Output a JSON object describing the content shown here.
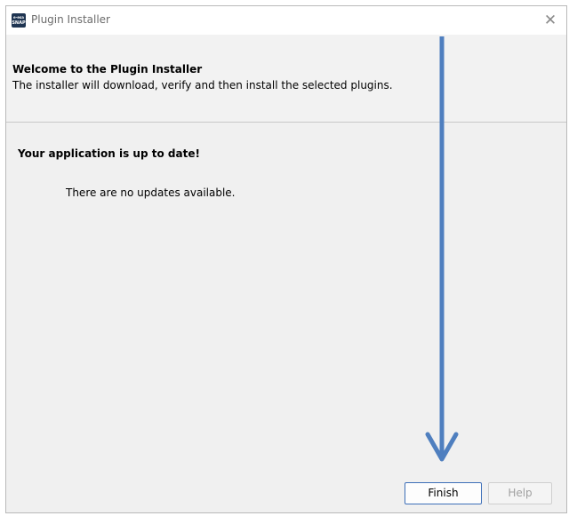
{
  "window": {
    "title": "Plugin Installer",
    "app_icon_top": "e·esa",
    "app_icon_bottom": "SNAP",
    "close_glyph": "✕"
  },
  "header": {
    "title": "Welcome to the Plugin Installer",
    "subtitle": "The installer will download, verify and then install the selected plugins."
  },
  "content": {
    "status_title": "Your application is up to date!",
    "status_message": "There are no updates available."
  },
  "buttons": {
    "finish_label": "Finish",
    "help_label": "Help"
  },
  "annotation": {
    "arrow_color": "#4f7fbf"
  }
}
